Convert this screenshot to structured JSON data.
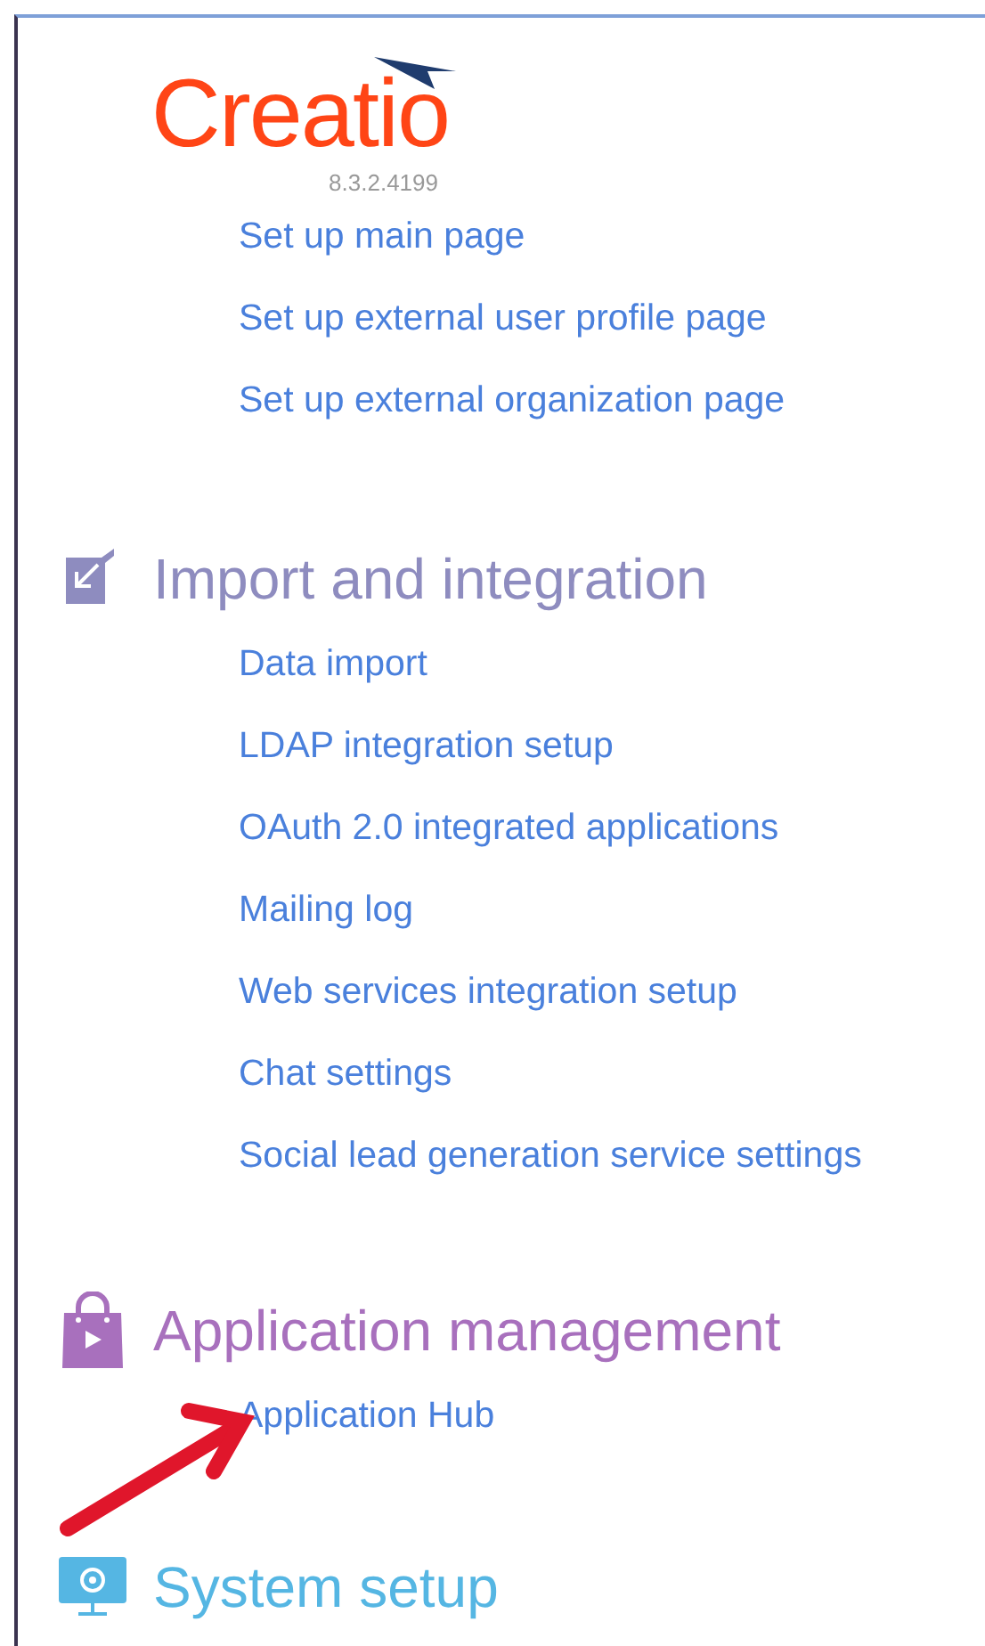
{
  "logo": {
    "text": "Creatio",
    "version": "8.3.2.4199"
  },
  "sections": [
    {
      "kind": "links",
      "links": [
        "Set up main page",
        "Set up external user profile page",
        "Set up external organization page"
      ]
    },
    {
      "kind": "import",
      "title": "Import and integration",
      "color": "#8e8cbf",
      "links": [
        "Data import",
        "LDAP integration setup",
        "OAuth 2.0 integrated applications",
        "Mailing log",
        "Web services integration setup",
        "Chat settings",
        "Social lead generation service settings"
      ]
    },
    {
      "kind": "apps",
      "title": "Application management",
      "color": "#a870bd",
      "links": [
        "Application Hub"
      ]
    },
    {
      "kind": "system",
      "title": "System setup",
      "color": "#55b6e3"
    }
  ]
}
